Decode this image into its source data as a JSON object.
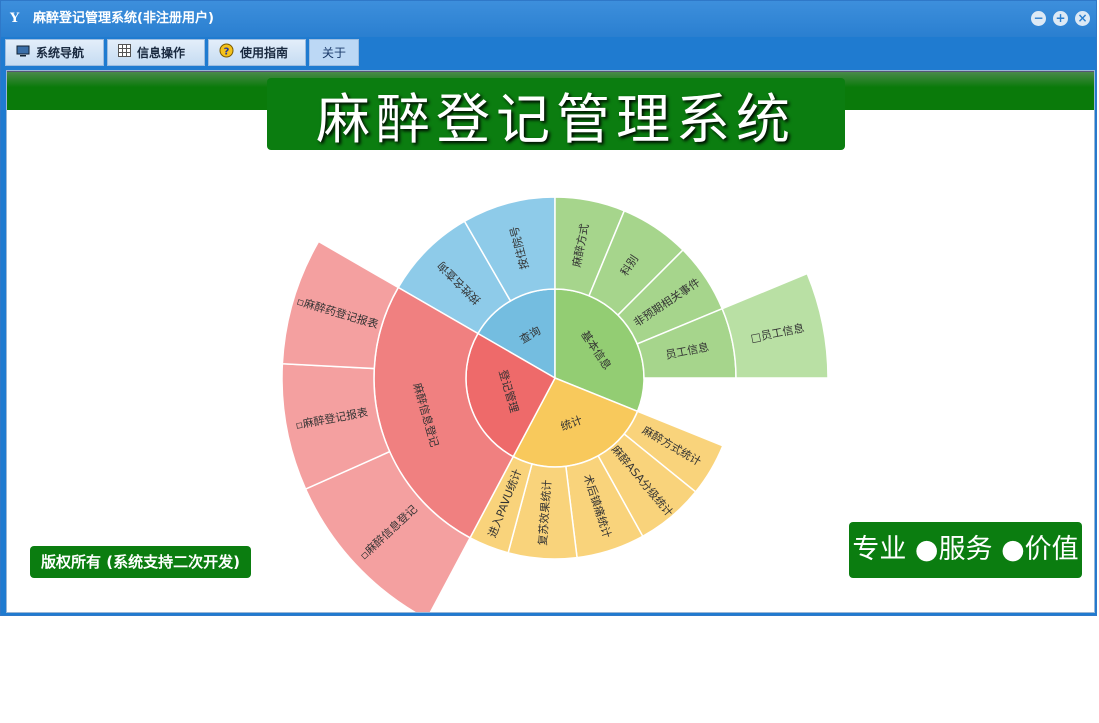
{
  "window": {
    "title": "麻醉登记管理系统(非注册用户)",
    "app_icon": "Y",
    "minimize_symbol": "−",
    "restore_symbol": "+",
    "close_symbol": "×"
  },
  "menu": {
    "items": [
      {
        "label": "系统导航",
        "icon": "monitor-icon"
      },
      {
        "label": "信息操作",
        "icon": "grid-icon"
      },
      {
        "label": "使用指南",
        "icon": "help-icon"
      },
      {
        "label": "关于",
        "icon": ""
      }
    ],
    "active_index": 3
  },
  "banner": {
    "title": "麻醉登记管理系统"
  },
  "footer": {
    "copyright": "版权所有 (系统支持二次开发)",
    "slogan": "专业 ●服务 ●价值"
  },
  "sunburst": {
    "colors": {
      "inner": {
        "query": "#74bde0",
        "basic": "#93cd73",
        "stats": "#f8c95c",
        "register": "#ee6a6a"
      },
      "middle": {
        "query": "#8ecbe9",
        "basic": "#a6d58c",
        "stats": "#f9d37b",
        "register": "#f08080"
      },
      "outer": {
        "basic": "#b9e0a4",
        "register": "#f4a0a0"
      }
    },
    "inner": [
      {
        "label": "查询",
        "key": "query"
      },
      {
        "label": "基本信息",
        "key": "basic"
      },
      {
        "label": "统计",
        "key": "stats"
      },
      {
        "label": "登记管理",
        "key": "register"
      }
    ],
    "middle": [
      {
        "label": "按姓名查询",
        "key": "query"
      },
      {
        "label": "按住院号",
        "key": "query"
      },
      {
        "label": "麻醉方式",
        "key": "basic"
      },
      {
        "label": "科别",
        "key": "basic"
      },
      {
        "label": "非预期相关事件",
        "key": "basic"
      },
      {
        "label": "员工信息",
        "key": "basic"
      },
      {
        "label": "麻醉方式统计",
        "key": "stats"
      },
      {
        "label": "麻醉ASA分级统计",
        "key": "stats"
      },
      {
        "label": "术后镇痛统计",
        "key": "stats"
      },
      {
        "label": "复苏效果统计",
        "key": "stats"
      },
      {
        "label": "进入PAVU统计",
        "key": "stats"
      },
      {
        "label": "麻醉信息登记",
        "key": "register"
      }
    ],
    "outer": [
      {
        "label": "□员工信息",
        "key": "basic"
      },
      {
        "label": "▫麻醉信息登记",
        "key": "register"
      },
      {
        "label": "▫麻醉登记报表",
        "key": "register"
      },
      {
        "label": "▫麻醉药登记报表",
        "key": "register"
      }
    ]
  }
}
